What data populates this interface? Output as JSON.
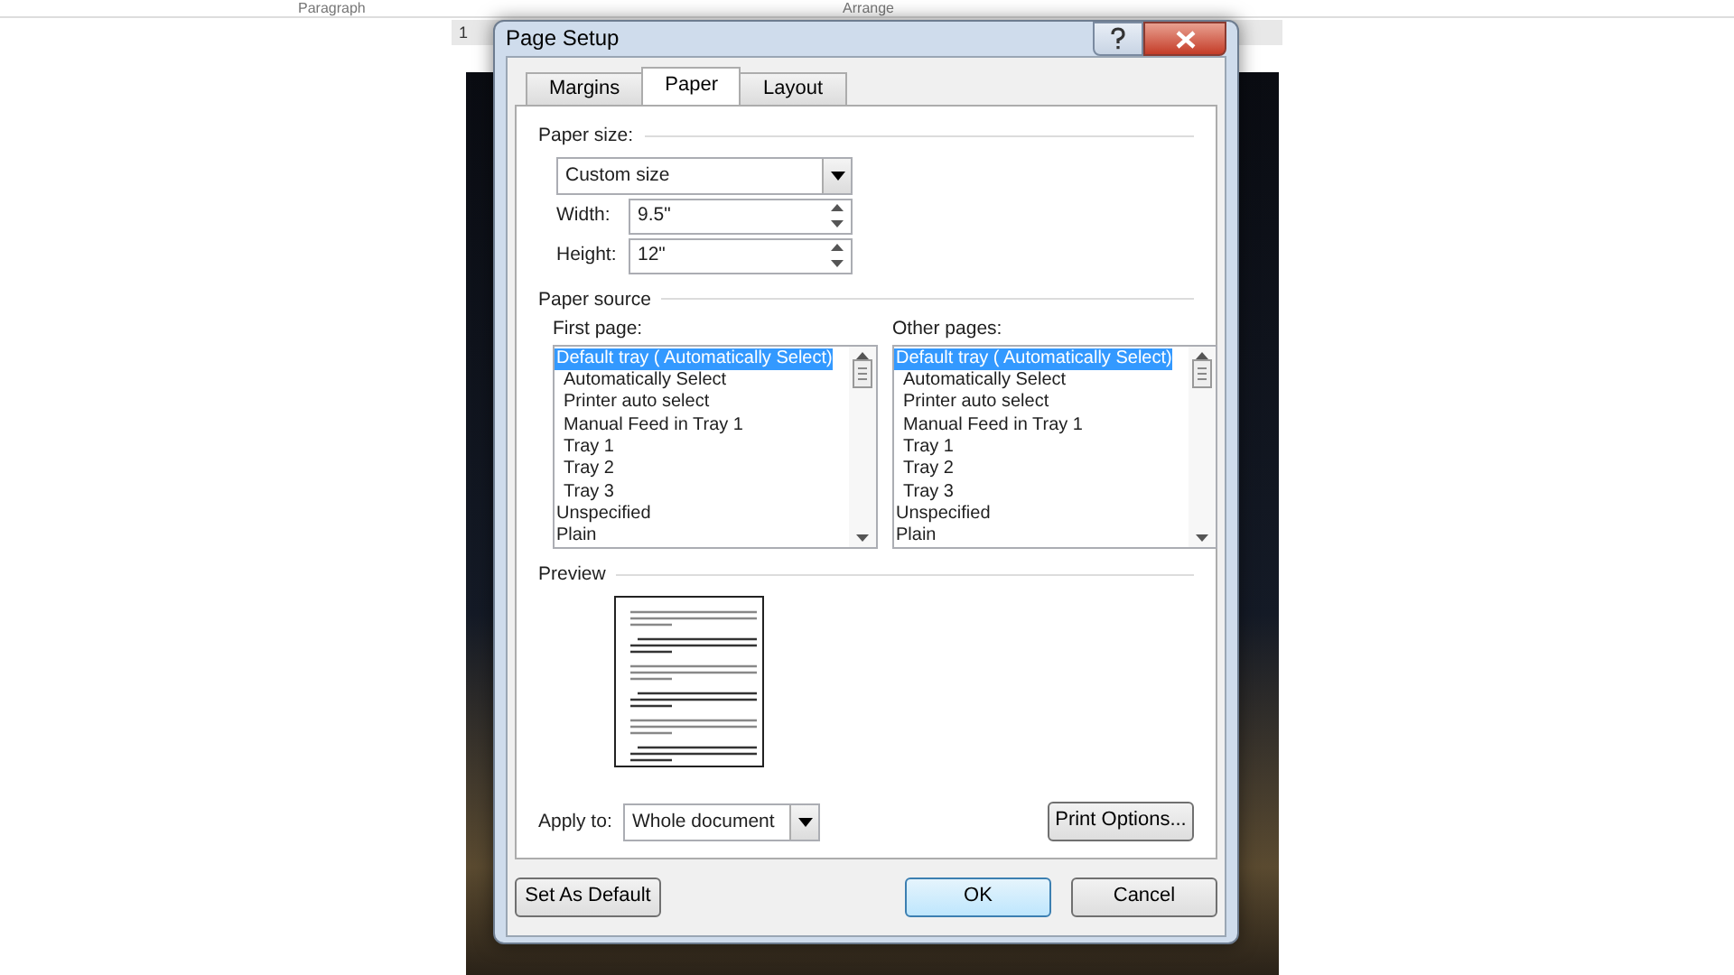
{
  "background": {
    "ribbon_labels": [
      "Paragraph",
      "Arrange"
    ],
    "ruler_number": "1"
  },
  "dialog": {
    "title": "Page Setup",
    "tabs": [
      {
        "label": "Margins",
        "selected": false
      },
      {
        "label": "Paper",
        "selected": true
      },
      {
        "label": "Layout",
        "selected": false
      }
    ],
    "paper_size": {
      "label": "Paper size:",
      "value": "Custom size",
      "width": {
        "label": "Width:",
        "value": "9.5\""
      },
      "height": {
        "label": "Height:",
        "value": "12\""
      }
    },
    "paper_source": {
      "label": "Paper source",
      "lists": [
        {
          "label": "First page:",
          "items": [
            {
              "text": "Default tray ( Automatically Select)",
              "selected": true,
              "indented": false
            },
            {
              "text": "Automatically Select",
              "selected": false,
              "indented": true
            },
            {
              "text": "Printer auto select",
              "selected": false,
              "indented": true
            },
            {
              "text": "Manual Feed in Tray 1",
              "selected": false,
              "indented": true
            },
            {
              "text": "Tray 1",
              "selected": false,
              "indented": true
            },
            {
              "text": "Tray 2",
              "selected": false,
              "indented": true
            },
            {
              "text": "Tray 3",
              "selected": false,
              "indented": true
            },
            {
              "text": "Unspecified",
              "selected": false,
              "indented": false
            },
            {
              "text": "Plain",
              "selected": false,
              "indented": false
            }
          ]
        },
        {
          "label": "Other pages:",
          "items": [
            {
              "text": "Default tray ( Automatically Select)",
              "selected": true,
              "indented": false
            },
            {
              "text": "Automatically Select",
              "selected": false,
              "indented": true
            },
            {
              "text": "Printer auto select",
              "selected": false,
              "indented": true
            },
            {
              "text": "Manual Feed in Tray 1",
              "selected": false,
              "indented": true
            },
            {
              "text": "Tray 1",
              "selected": false,
              "indented": true
            },
            {
              "text": "Tray 2",
              "selected": false,
              "indented": true
            },
            {
              "text": "Tray 3",
              "selected": false,
              "indented": true
            },
            {
              "text": "Unspecified",
              "selected": false,
              "indented": false
            },
            {
              "text": "Plain",
              "selected": false,
              "indented": false
            }
          ]
        }
      ]
    },
    "preview": {
      "label": "Preview"
    },
    "apply_to": {
      "label": "Apply to:",
      "value": "Whole document"
    },
    "print_options": {
      "label": "Print Options..."
    },
    "buttons": [
      {
        "label": "Set As Default",
        "default": false
      },
      {
        "label": "OK",
        "default": true
      },
      {
        "label": "Cancel",
        "default": false
      }
    ]
  }
}
